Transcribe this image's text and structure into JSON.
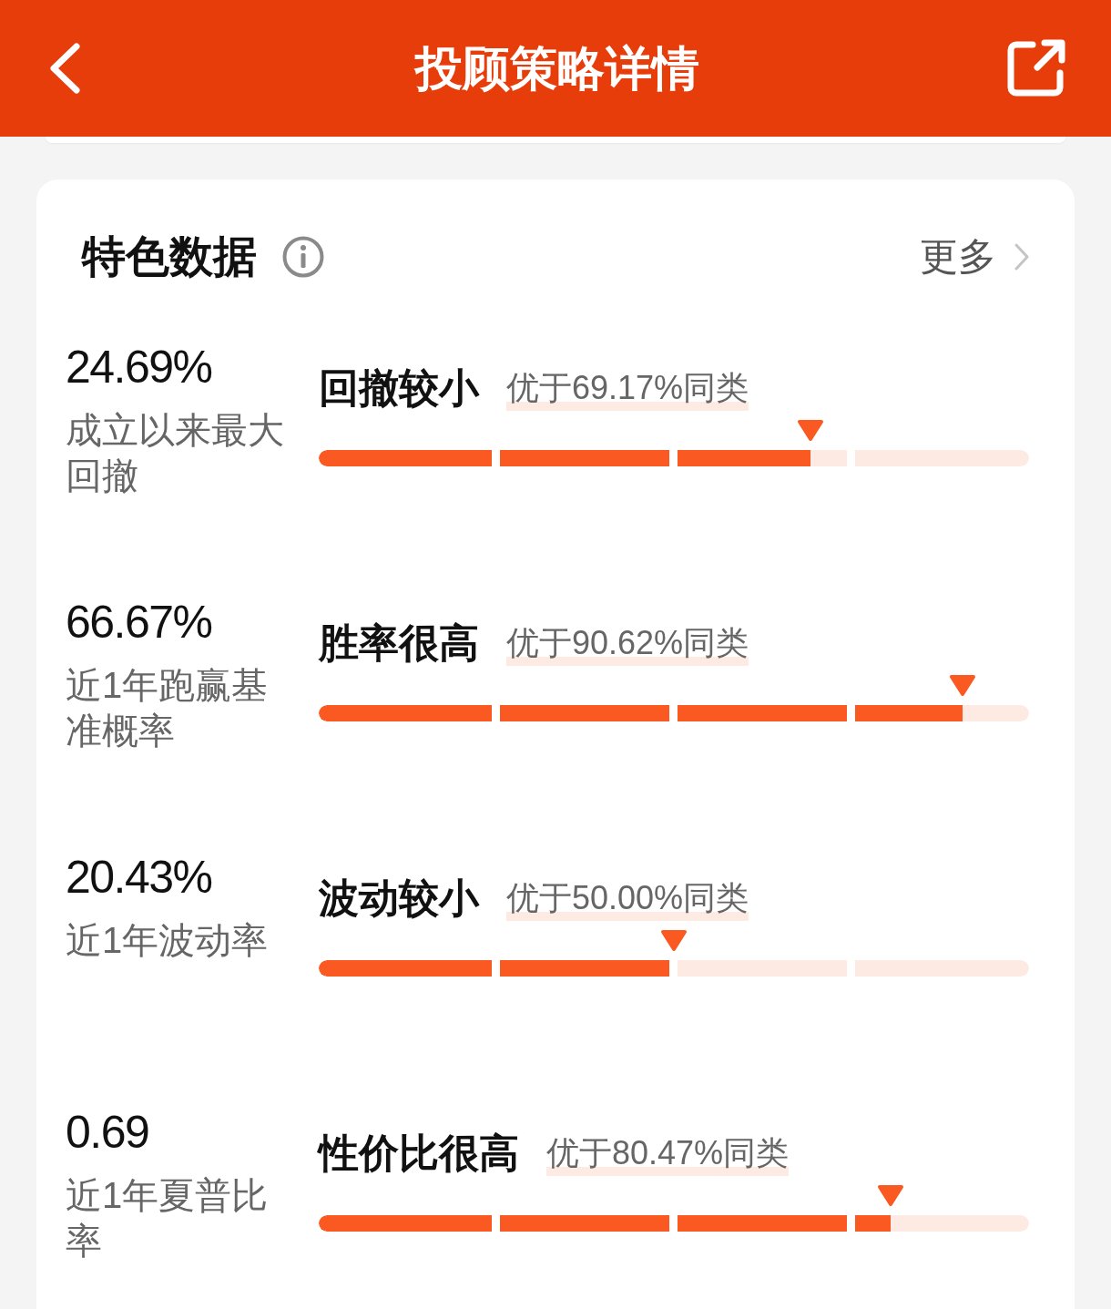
{
  "header": {
    "title": "投顾策略详情"
  },
  "section": {
    "title": "特色数据",
    "more": "更多"
  },
  "metrics": [
    {
      "value": "24.69%",
      "label": "成立以来最大回撤",
      "verdict": "回撤较小",
      "comparison": "优于69.17%同类",
      "level": 0.6917
    },
    {
      "value": "66.67%",
      "label": "近1年跑赢基准概率",
      "verdict": "胜率很高",
      "comparison": "优于90.62%同类",
      "level": 0.9062
    },
    {
      "value": "20.43%",
      "label": "近1年波动率",
      "verdict": "波动较小",
      "comparison": "优于50.00%同类",
      "level": 0.5
    },
    {
      "value": "0.69",
      "label": "近1年夏普比率",
      "verdict": "性价比很高",
      "comparison": "优于80.47%同类",
      "level": 0.8047
    }
  ]
}
